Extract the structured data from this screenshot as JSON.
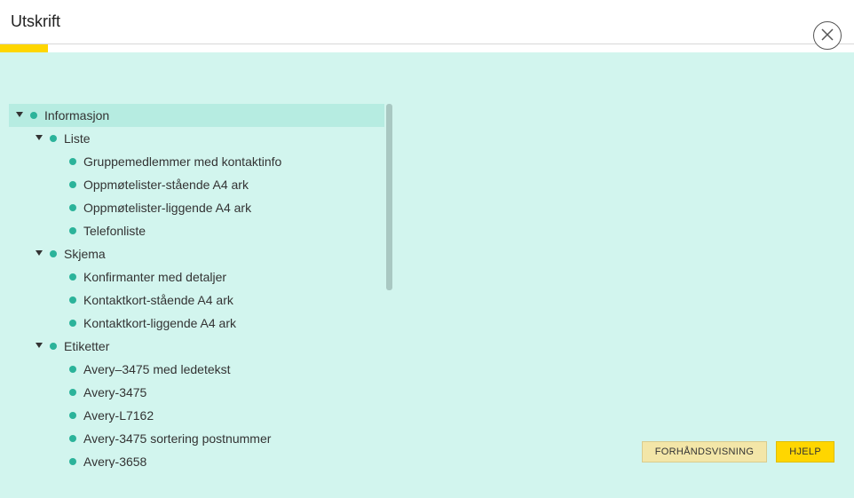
{
  "header": {
    "title": "Utskrift"
  },
  "buttons": {
    "preview": "FORHÅNDSVISNING",
    "help": "HJELP"
  },
  "tree": {
    "root": {
      "label": "Informasjon",
      "expanded": true,
      "selected": true,
      "children": [
        {
          "label": "Liste",
          "expanded": true,
          "children": [
            {
              "label": "Gruppemedlemmer med kontaktinfo"
            },
            {
              "label": "Oppmøtelister-stående A4 ark"
            },
            {
              "label": "Oppmøtelister-liggende A4 ark"
            },
            {
              "label": "Telefonliste"
            }
          ]
        },
        {
          "label": "Skjema",
          "expanded": true,
          "children": [
            {
              "label": "Konfirmanter med detaljer"
            },
            {
              "label": "Kontaktkort-stående A4 ark"
            },
            {
              "label": "Kontaktkort-liggende A4 ark"
            }
          ]
        },
        {
          "label": "Etiketter",
          "expanded": true,
          "children": [
            {
              "label": "Avery–3475 med ledetekst"
            },
            {
              "label": "Avery-3475"
            },
            {
              "label": "Avery-L7162"
            },
            {
              "label": "Avery-3475 sortering postnummer"
            },
            {
              "label": "Avery-3658"
            }
          ]
        }
      ]
    }
  }
}
